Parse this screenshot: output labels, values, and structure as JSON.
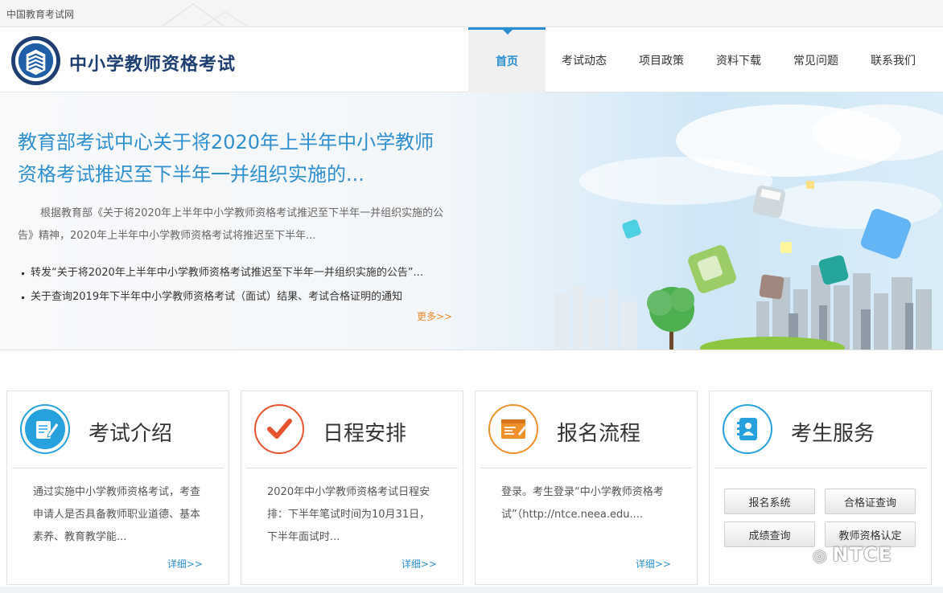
{
  "topbar": {
    "site_name": "中国教育考试网"
  },
  "header": {
    "brand": "中小学教师资格考试",
    "nav": [
      {
        "label": "首页",
        "active": true
      },
      {
        "label": "考试动态"
      },
      {
        "label": "项目政策"
      },
      {
        "label": "资料下载"
      },
      {
        "label": "常见问题"
      },
      {
        "label": "联系我们"
      }
    ]
  },
  "hero": {
    "title": "教育部考试中心关于将2020年上半年中小学教师资格考试推迟至下半年一并组织实施的...",
    "summary": "根据教育部《关于将2020年上半年中小学教师资格考试推迟至下半年一并组织实施的公告》精神，2020年上半年中小学教师资格考试将推迟至下半年...",
    "news": [
      "转发“关于将2020年上半年中小学教师资格考试推迟至下半年一并组织实施的公告”...",
      "关于查询2019年下半年中小学教师资格考试（面试）结果、考试合格证明的通知"
    ],
    "more": "更多>>"
  },
  "cards": [
    {
      "title": "考试介绍",
      "icon": "pen-document-icon",
      "desc": "通过实施中小学教师资格考试，考查申请人是否具备教师职业道德、基本素养、教育教学能...",
      "detail": "详细>>"
    },
    {
      "title": "日程安排",
      "icon": "checkmark-icon",
      "desc": "2020年中小学教师资格考试日程安排：下半年笔试时间为10月31日，下半年面试时...",
      "detail": "详细>>"
    },
    {
      "title": "报名流程",
      "icon": "registration-form-icon",
      "desc": "登录。考生登录“中小学教师资格考试”（http://ntce.neea.edu....",
      "detail": "详细>>"
    },
    {
      "title": "考生服务",
      "icon": "contact-book-icon"
    }
  ],
  "services": [
    "报名系统",
    "合格证查询",
    "成绩查询",
    "教师资格认定"
  ],
  "watermark": "NTCE",
  "colors": {
    "accent": "#2a8fd0",
    "brand": "#1f3f73",
    "more": "#e8892b",
    "card_red": "#e6532f",
    "card_orange": "#f0902a",
    "card_blue": "#27a0de"
  }
}
